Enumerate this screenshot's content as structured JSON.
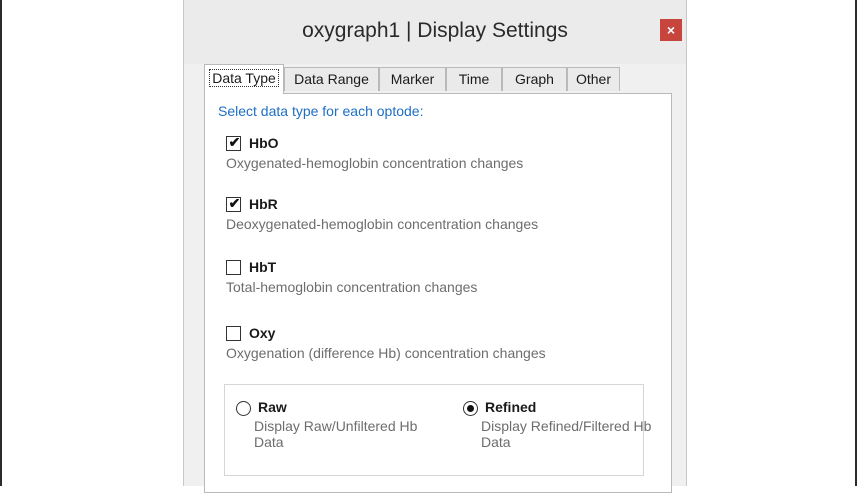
{
  "dialog": {
    "title": "oxygraph1 | Display Settings",
    "close_label": "×"
  },
  "tabs": [
    {
      "label": "Data Type",
      "active": true
    },
    {
      "label": "Data Range",
      "active": false
    },
    {
      "label": "Marker",
      "active": false
    },
    {
      "label": "Time",
      "active": false
    },
    {
      "label": "Graph",
      "active": false
    },
    {
      "label": "Other",
      "active": false
    }
  ],
  "panel": {
    "heading": "Select data type for each optode:",
    "options": [
      {
        "title": "HbO",
        "description": "Oxygenated-hemoglobin concentration changes",
        "checked": true
      },
      {
        "title": "HbR",
        "description": "Deoxygenated-hemoglobin concentration changes",
        "checked": true
      },
      {
        "title": "HbT",
        "description": "Total-hemoglobin concentration changes",
        "checked": false
      },
      {
        "title": "Oxy",
        "description": "Oxygenation (difference Hb) concentration changes",
        "checked": false
      }
    ],
    "check_mark": "✔",
    "radios": [
      {
        "title": "Raw",
        "description": "Display Raw/Unfiltered Hb Data",
        "selected": false
      },
      {
        "title": "Refined",
        "description": "Display Refined/Filtered Hb Data",
        "selected": true
      }
    ]
  },
  "colors": {
    "heading": "#1e6fc4",
    "close_button": "#c7453c",
    "description_text": "#6d6d6d"
  },
  "icons": {
    "close": "close-icon",
    "checkbox": "checkbox-icon",
    "radio": "radio-icon"
  }
}
